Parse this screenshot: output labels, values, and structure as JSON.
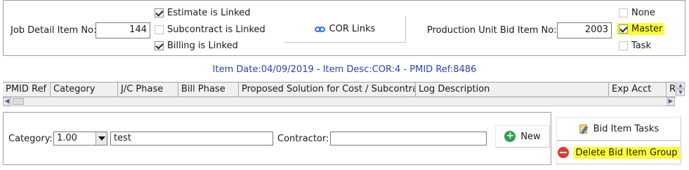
{
  "job_detail": {
    "label": "Job Detail Item No:",
    "value": "144"
  },
  "links": {
    "estimate": {
      "label": "Estimate is Linked",
      "checked": true
    },
    "subcontract": {
      "label": "Subcontract is Linked",
      "checked": false
    },
    "billing": {
      "label": "Billing is Linked",
      "checked": true
    },
    "cor_button": "COR Links"
  },
  "production": {
    "label": "Production Unit Bid Item No:",
    "value": "2003"
  },
  "bid_type": {
    "none": {
      "label": "None",
      "checked": false
    },
    "master": {
      "label": "Master",
      "checked": true,
      "highlight": "#ffff33"
    },
    "task": {
      "label": "Task",
      "checked": false
    }
  },
  "item_info": "Item Date:04/09/2019 - Item Desc:COR:4 - PMID Ref:8486",
  "grid": {
    "columns": [
      "PMID Ref",
      "Category",
      "J/C Phase",
      "Bill Phase",
      "Proposed Solution for Cost / Subcontract",
      "Log Description",
      "Exp Acct",
      "R"
    ]
  },
  "form": {
    "category_label": "Category:",
    "category_value": "1.00",
    "description_value": "test",
    "contractor_label": "Contractor:",
    "contractor_value": "",
    "new_button": "New"
  },
  "actions": {
    "bid_item_tasks": "Bid Item Tasks",
    "delete_bid_item_group": "Delete Bid Item Group"
  },
  "colors": {
    "info_text": "#2a45a8",
    "highlight": "#ffff33",
    "new_icon": "#2e9e4a",
    "delete_icon": "#e03a2a",
    "link_icon": "#2f6fcf"
  }
}
